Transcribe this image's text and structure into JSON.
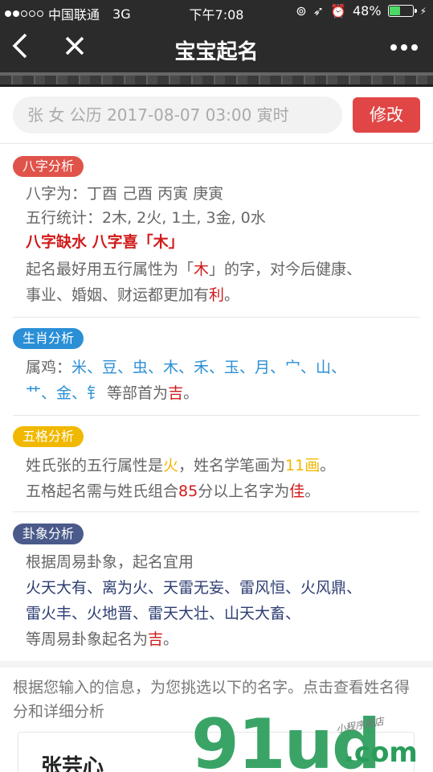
{
  "status_bar": {
    "carrier": "中国联通",
    "network": "3G",
    "time": "下午7:08",
    "battery": "48%",
    "battery_level": 0.48
  },
  "nav": {
    "title": "宝宝起名",
    "back_icon": "chevron-left-icon",
    "close_icon": "close-icon",
    "more_icon": "more-icon"
  },
  "search": {
    "value": "张 女 公历 2017-08-07 03:00 寅时",
    "button": "修改"
  },
  "sections": {
    "bazi": {
      "badge": "八字分析",
      "line1": "八字为：丁酉 己酉 丙寅 庚寅",
      "line2": "五行统计：2木, 2火, 1土, 3金, 0水",
      "line3": "八字缺水 八字喜「木」",
      "line4_a": "起名最好用五行属性为「",
      "line4_b": "木",
      "line4_c": "」的字，对今后健康、",
      "line5_a": "事业、婚姻、财运都更加有",
      "line5_b": "利",
      "line5_c": "。"
    },
    "shengxiao": {
      "badge": "生肖分析",
      "line1_a": "属鸡：",
      "line1_b": "米、豆、虫、木、禾、玉、月、宀、山、",
      "line2_a": "艹、金、钅",
      "line2_b": " 等部首为",
      "line2_c": "吉",
      "line2_d": "。"
    },
    "wuge": {
      "badge": "五格分析",
      "line1_a": "姓氏张的五行属性是",
      "line1_b": "火",
      "line1_c": "，姓名学笔画为",
      "line1_d": "11画",
      "line1_e": "。",
      "line2_a": "五格起名需与姓氏组合",
      "line2_b": "85",
      "line2_c": "分以上名字为",
      "line2_d": "佳",
      "line2_e": "。"
    },
    "guaxiang": {
      "badge": "卦象分析",
      "line1": "根据周易卦象，起名宜用",
      "line2": "火天大有、离为火、天雷无妄、雷风恒、火风鼎、",
      "line3": "雷火丰、火地晋、雷天大壮、山天大畜、",
      "line4_a": "等周易卦象起名为",
      "line4_b": "吉",
      "line4_c": "。"
    }
  },
  "footer": {
    "note": "根据您输入的信息，为您挑选以下的名字。点击查看姓名得分和详细分析",
    "first_name": "张芸心"
  },
  "watermark": {
    "main": "91ud",
    "suffix": ".com",
    "small": "小程序商店"
  },
  "colors": {
    "bazi_badge": "#e0534a",
    "shengxiao_badge": "#2a8fd6",
    "wuge_badge": "#f1b800",
    "guaxiang_badge": "#4a5a8a",
    "accent_red": "#e04646"
  }
}
